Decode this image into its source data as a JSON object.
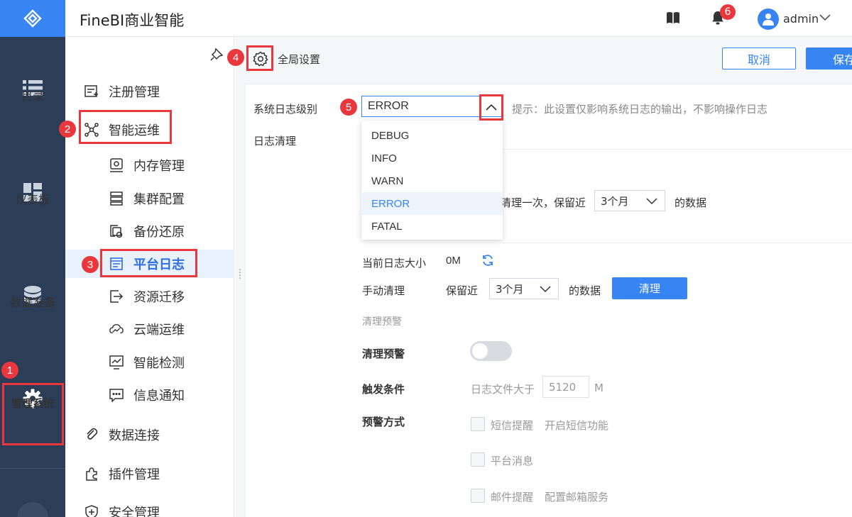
{
  "app": {
    "title": "FineBI商业智能",
    "notification_count": "6",
    "username": "admin"
  },
  "rail": {
    "items": [
      {
        "label": "目录",
        "icon": "list-icon"
      },
      {
        "label": "仪表板",
        "icon": "dashboard-icon"
      },
      {
        "label": "数据准备",
        "icon": "database-icon"
      },
      {
        "label": "管理系统",
        "icon": "gear-icon",
        "active": true
      }
    ]
  },
  "subnav": {
    "items": [
      {
        "label": "注册管理",
        "icon": "register-icon"
      },
      {
        "label": "智能运维",
        "icon": "ops-icon"
      },
      {
        "label": "内存管理",
        "icon": "memory-icon"
      },
      {
        "label": "集群配置",
        "icon": "cluster-icon"
      },
      {
        "label": "备份还原",
        "icon": "backup-icon"
      },
      {
        "label": "平台日志",
        "icon": "log-icon",
        "selected": true
      },
      {
        "label": "资源迁移",
        "icon": "migrate-icon"
      },
      {
        "label": "云端运维",
        "icon": "cloud-icon"
      },
      {
        "label": "智能检测",
        "icon": "monitor-icon"
      },
      {
        "label": "信息通知",
        "icon": "message-icon"
      },
      {
        "label": "数据连接",
        "icon": "link-icon"
      },
      {
        "label": "插件管理",
        "icon": "plugin-icon"
      },
      {
        "label": "安全管理",
        "icon": "shield-icon"
      }
    ]
  },
  "steps": [
    "1",
    "2",
    "3",
    "4",
    "5"
  ],
  "main": {
    "title": "全局设置",
    "cancel_label": "取消",
    "save_label": "保存",
    "log_level_label": "系统日志级别",
    "log_level_value": "ERROR",
    "log_level_hint": "提示：此设置仅影响系统日志的输出，不影响操作日志",
    "log_level_options": [
      "DEBUG",
      "INFO",
      "WARN",
      "ERROR",
      "FATAL"
    ],
    "log_clean_label": "日志清理",
    "auto_clean_text": "清理一次，保留近",
    "auto_clean_retain": "3个月",
    "auto_clean_suffix": "的数据",
    "current_size_label": "当前日志大小",
    "current_size_value": "0M",
    "manual_clean_label": "手动清理",
    "manual_retain_label": "保留近",
    "manual_retain_value": "3个月",
    "manual_suffix": "的数据",
    "clear_button": "清理",
    "warning_section": "清理预警",
    "warning_toggle_label": "清理预警",
    "trigger_label": "触发条件",
    "trigger_text": "日志文件大于",
    "trigger_value": "5120",
    "trigger_unit": "M",
    "warn_method_label": "预警方式",
    "sms_label": "短信提醒",
    "sms_link": "开启短信功能",
    "platform_msg_label": "平台消息",
    "email_label": "邮件提醒",
    "email_link": "配置邮箱服务"
  }
}
